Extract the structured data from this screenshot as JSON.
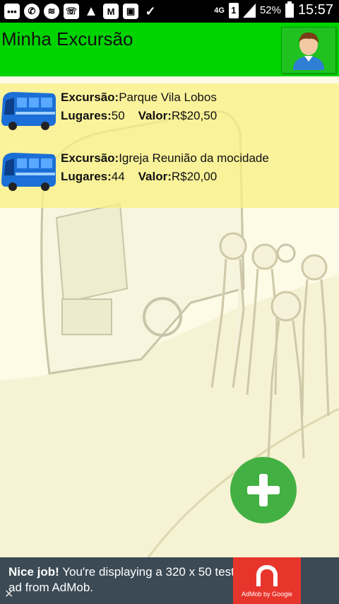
{
  "status_bar": {
    "icons": [
      "messages-icon",
      "whatsapp-icon",
      "wifi-icon",
      "calendar-icon",
      "warning-icon",
      "gmail-icon",
      "gallery-icon",
      "check-icon"
    ],
    "network": "4G",
    "sim": "1",
    "battery": "52%",
    "time": "15:57"
  },
  "appbar": {
    "title": "Minha Excursão",
    "profile_icon": "person-avatar-icon"
  },
  "excursions": [
    {
      "excursao_label": "Excursão:",
      "excursao_value": "Parque Vila Lobos",
      "lugares_label": "Lugares:",
      "lugares_value": "50",
      "valor_label": "Valor:",
      "valor_value": "R$20,50"
    },
    {
      "excursao_label": "Excursão:",
      "excursao_value": "Igreja Reunião da mocidade",
      "lugares_label": "Lugares:",
      "lugares_value": "44",
      "valor_label": "Valor:",
      "valor_value": "R$20,00"
    }
  ],
  "fab": {
    "icon": "plus-icon"
  },
  "ad": {
    "bold": "Nice job!",
    "text": " You're displaying a 320 x 50 test ad from AdMob.",
    "close": "✕",
    "logo_text": "AdMob by Google"
  },
  "colors": {
    "appbar": "#00d400",
    "list_bg": "#f7ee8a",
    "fab": "#43b043",
    "ad_bg": "#3b4a55",
    "ad_logo": "#e8352c"
  }
}
